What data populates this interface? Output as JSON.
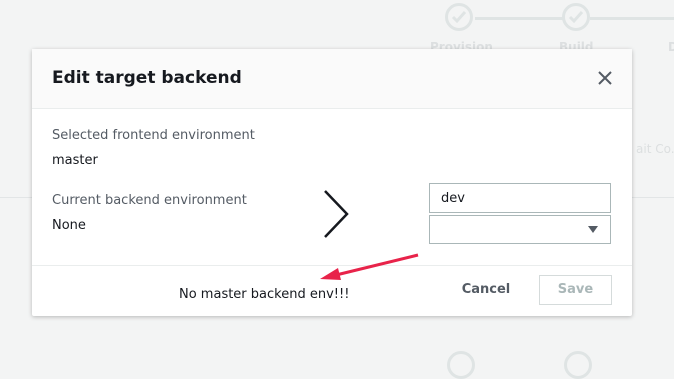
{
  "background": {
    "steps": [
      {
        "label": "Provision"
      },
      {
        "label": "Build"
      },
      {
        "label": "D"
      }
    ],
    "side_text": "ait Co..."
  },
  "modal": {
    "title": "Edit target backend",
    "close_icon": "close-icon",
    "frontend_label": "Selected frontend environment",
    "frontend_value": "master",
    "backend_label": "Current backend environment",
    "backend_value": "None",
    "chevron_icon": "chevron-right-icon",
    "env_input_value": "dev",
    "select_value": "",
    "note": "No master backend env!!!",
    "cancel_label": "Cancel",
    "save_label": "Save"
  },
  "colors": {
    "annotation_arrow": "#e8234a",
    "save_disabled_text": "#aab7b8",
    "backdrop": "#f3f4f4"
  }
}
